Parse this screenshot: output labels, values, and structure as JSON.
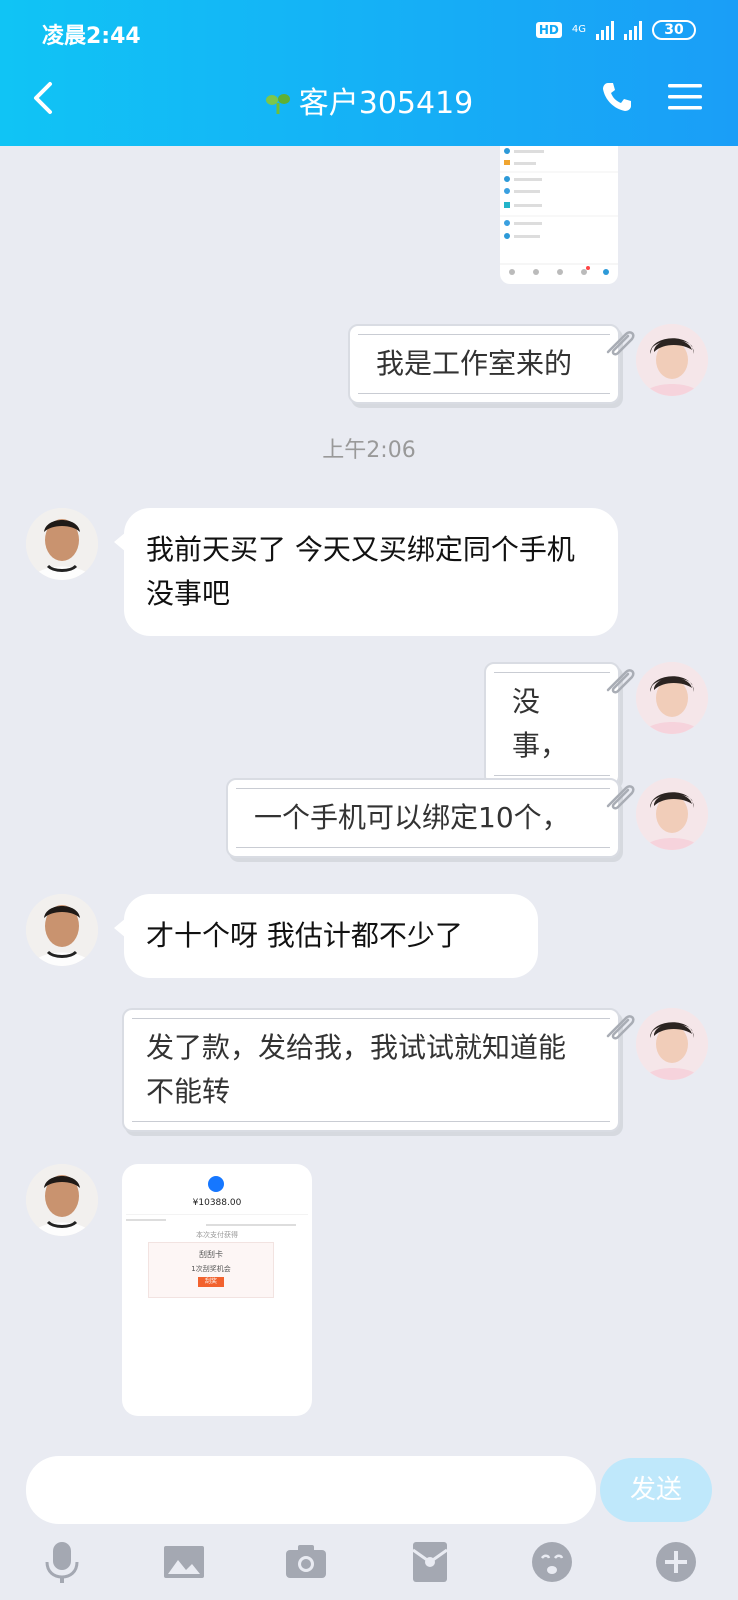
{
  "status_bar": {
    "time": "凌晨2:44",
    "hd": "HD",
    "network": "4G",
    "battery": "30"
  },
  "header": {
    "title": "客户305419"
  },
  "messages": [
    {
      "from": "self",
      "text": "我是工作室来的"
    },
    {
      "timestamp": "上午2:06"
    },
    {
      "from": "other",
      "text": "我前天买了  今天又买绑定同个手机没事吧"
    },
    {
      "from": "self",
      "text": "没事，"
    },
    {
      "from": "self",
      "text": "一个手机可以绑定10个，"
    },
    {
      "from": "other",
      "text": "才十个呀  我估计都不少了"
    },
    {
      "from": "self",
      "text": "发了款，发给我，我试试就知道能不能转"
    }
  ],
  "receipt": {
    "amount": "¥10388.00",
    "section": "本次支付获得",
    "card_title": "刮刮卡",
    "card_sub": "1次刮奖机会",
    "card_button": "刮奖"
  },
  "input": {
    "placeholder": "",
    "send_label": "发送"
  },
  "colors": {
    "header_start": "#10c4f5",
    "header_end": "#1a9ef7",
    "send_bg": "#bfe8fb"
  }
}
